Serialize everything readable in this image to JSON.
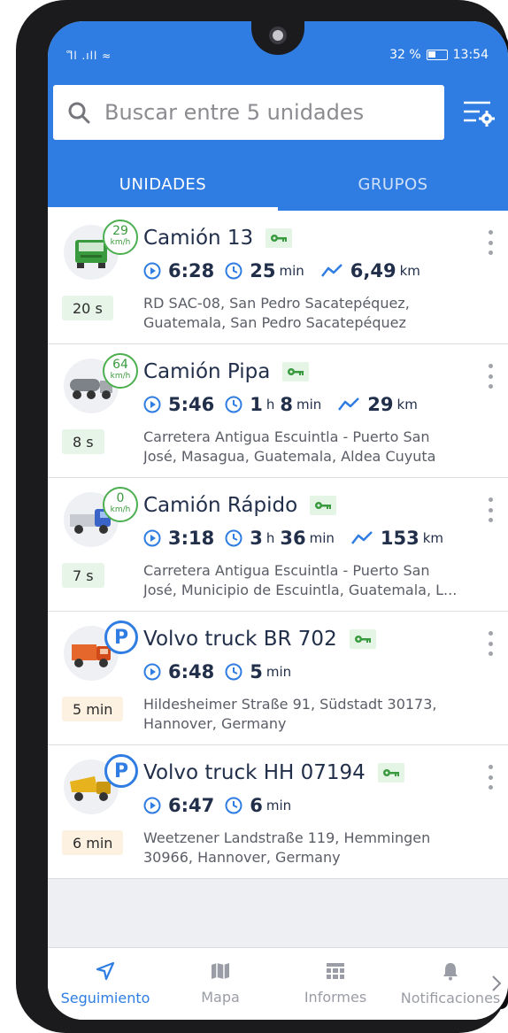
{
  "status_bar": {
    "signal": "᪲ll .ıll ≈",
    "battery": "32 %",
    "time": "13:54"
  },
  "search": {
    "placeholder": "Buscar entre 5 unidades"
  },
  "tabs": [
    {
      "label": "UNIDADES",
      "active": true
    },
    {
      "label": "GRUPOS",
      "active": false
    }
  ],
  "units": [
    {
      "name": "Camión 13",
      "badge_type": "speed",
      "speed": "29",
      "speed_unit": "km/h",
      "elapsed": "20 s",
      "elapsed_style": "green",
      "time": "6:28",
      "dur_a": "25",
      "dur_a_unit": "min",
      "dur_b": "",
      "dur_b_unit": "",
      "distance": "6,49",
      "distance_unit": "km",
      "address_1": "RD SAC-08, San Pedro Sacatepéquez,",
      "address_2": "Guatemala, San Pedro Sacatepéquez",
      "icon": "green-truck-icon",
      "color": "#3a9a3e"
    },
    {
      "name": "Camión Pipa",
      "badge_type": "speed",
      "speed": "64",
      "speed_unit": "km/h",
      "elapsed": "8 s",
      "elapsed_style": "green",
      "time": "5:46",
      "dur_a": "1",
      "dur_a_unit": "h",
      "dur_b": "8",
      "dur_b_unit": "min",
      "distance": "29",
      "distance_unit": "km",
      "address_1": "Carretera Antigua Escuintla - Puerto San",
      "address_2": "José, Masagua, Guatemala, Aldea Cuyuta",
      "icon": "tanker-truck-icon",
      "color": "#7d8288"
    },
    {
      "name": "Camión Rápido",
      "badge_type": "speed",
      "speed": "0",
      "speed_unit": "km/h",
      "elapsed": "7 s",
      "elapsed_style": "green",
      "time": "3:18",
      "dur_a": "3",
      "dur_a_unit": "h",
      "dur_b": "36",
      "dur_b_unit": "min",
      "distance": "153",
      "distance_unit": "km",
      "address_1": "Carretera Antigua Escuintla - Puerto San",
      "address_2": "José, Municipio de Escuintla, Guatemala, L...",
      "icon": "blue-truck-icon",
      "color": "#3a64c8"
    },
    {
      "name": "Volvo truck BR 702",
      "badge_type": "parking",
      "parking_label": "P",
      "elapsed": "5 min",
      "elapsed_style": "orange",
      "time": "6:48",
      "dur_a": "5",
      "dur_a_unit": "min",
      "dur_b": "",
      "dur_b_unit": "",
      "distance": "",
      "distance_unit": "",
      "address_1": "Hildesheimer Straße 91, Südstadt 30173,",
      "address_2": "Hannover, Germany",
      "icon": "orange-truck-icon",
      "color": "#e5672c"
    },
    {
      "name": "Volvo truck HH 07194",
      "badge_type": "parking",
      "parking_label": "P",
      "elapsed": "6 min",
      "elapsed_style": "orange",
      "time": "6:47",
      "dur_a": "6",
      "dur_a_unit": "min",
      "dur_b": "",
      "dur_b_unit": "",
      "distance": "",
      "distance_unit": "",
      "address_1": "Weetzener Landstraße 119, Hemmingen",
      "address_2": "30966, Hannover, Germany",
      "icon": "yellow-dump-truck-icon",
      "color": "#e6b21e"
    }
  ],
  "bottom_nav": [
    {
      "label": "Seguimiento",
      "icon": "navigation-arrow-icon",
      "active": true
    },
    {
      "label": "Mapa",
      "icon": "map-icon",
      "active": false
    },
    {
      "label": "Informes",
      "icon": "table-icon",
      "active": false
    },
    {
      "label": "Notificaciones",
      "icon": "bell-icon",
      "active": false
    }
  ],
  "colors": {
    "primary": "#2f7de2",
    "moving_green": "#4caf50",
    "text_dark": "#222f4a"
  }
}
